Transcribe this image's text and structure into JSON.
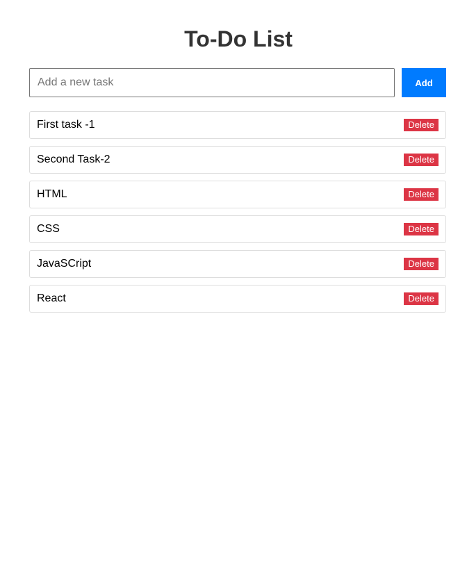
{
  "header": {
    "title": "To-Do List"
  },
  "add_form": {
    "input_value": "",
    "input_placeholder": "Add a new task",
    "add_label": "Add"
  },
  "tasks": [
    {
      "text": "First task -1",
      "delete_label": "Delete"
    },
    {
      "text": "Second Task-2",
      "delete_label": "Delete"
    },
    {
      "text": "HTML",
      "delete_label": "Delete"
    },
    {
      "text": "CSS",
      "delete_label": "Delete"
    },
    {
      "text": "JavaSCript",
      "delete_label": "Delete"
    },
    {
      "text": "React",
      "delete_label": "Delete"
    }
  ],
  "colors": {
    "add_button": "#007bff",
    "delete_button": "#dc3545",
    "title": "#333333"
  }
}
